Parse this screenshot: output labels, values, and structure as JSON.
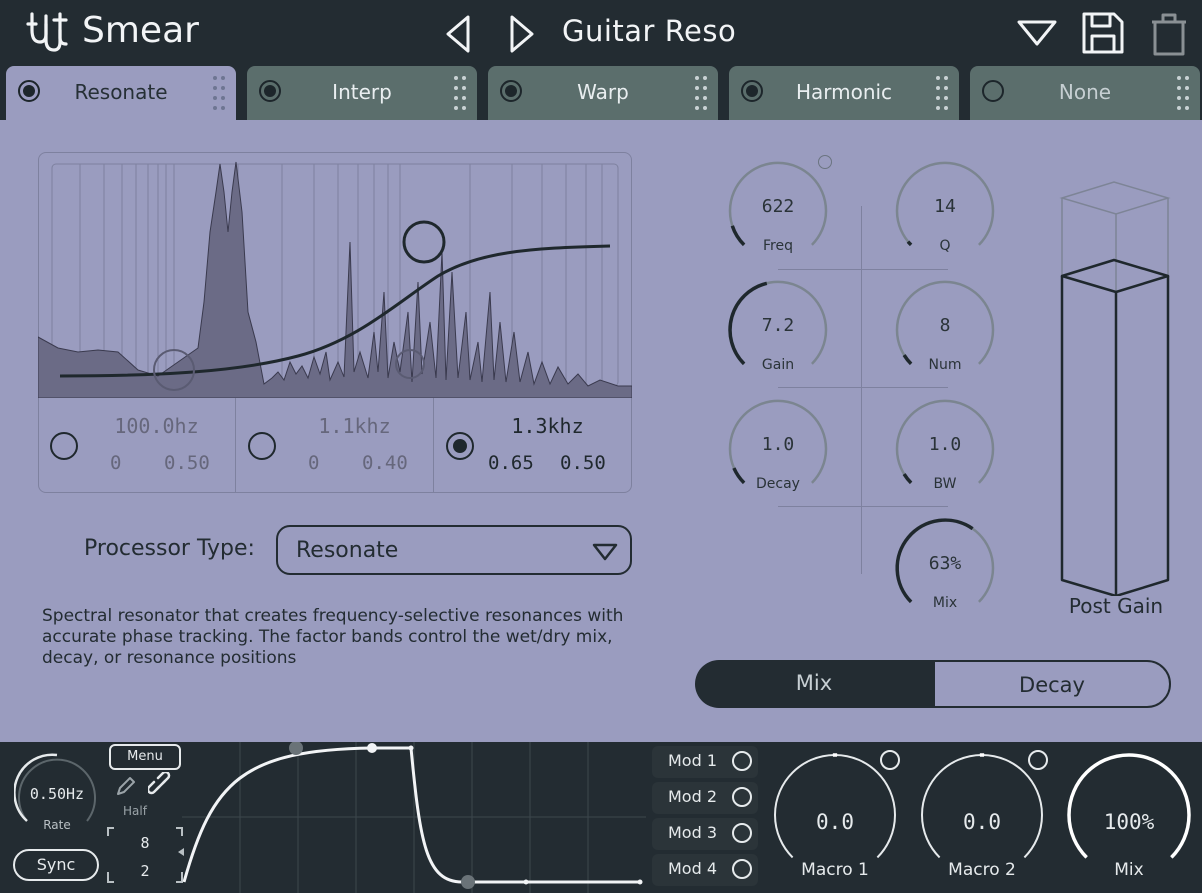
{
  "app": {
    "name": "Smear",
    "preset_name": "Guitar Reso"
  },
  "tabs": [
    {
      "label": "Resonate",
      "enabled": true
    },
    {
      "label": "Interp",
      "enabled": true
    },
    {
      "label": "Warp",
      "enabled": true
    },
    {
      "label": "Harmonic",
      "enabled": true
    },
    {
      "label": "None",
      "enabled": false
    }
  ],
  "bands": [
    {
      "freq": "100.0hz",
      "v1": "0",
      "v2": "0.50",
      "selected": false
    },
    {
      "freq": "1.1khz",
      "v1": "0",
      "v2": "0.40",
      "selected": false
    },
    {
      "freq": "1.3khz",
      "v1": "0.65",
      "v2": "0.50",
      "selected": true
    }
  ],
  "processor": {
    "label": "Processor Type:",
    "value": "Resonate"
  },
  "description": "Spectral resonator that creates frequency-selective resonances with accurate phase tracking. The factor bands control the wet/dry mix, decay, or resonance positions",
  "knobs": {
    "freq": {
      "value": "622",
      "label": "Freq",
      "level": 0.1
    },
    "q": {
      "value": "14",
      "label": "Q",
      "level": 0.02
    },
    "gain": {
      "value": "7.2",
      "label": "Gain",
      "level": 0.45
    },
    "num": {
      "value": "8",
      "label": "Num",
      "level": 0.05
    },
    "decay": {
      "value": "1.0",
      "label": "Decay",
      "level": 0.08
    },
    "bw": {
      "value": "1.0",
      "label": "BW",
      "level": 0.05
    },
    "mix": {
      "value": "63%",
      "label": "Mix",
      "level": 0.63
    }
  },
  "factor_mode": {
    "options": [
      "Mix",
      "Decay"
    ],
    "selected": "Mix"
  },
  "post_gain": {
    "label": "Post Gain",
    "level": 0.8
  },
  "lfo": {
    "rate": "0.50Hz",
    "rate_label": "Rate",
    "rate_level": 0.5,
    "sync_label": "Sync",
    "menu_label": "Menu",
    "half_label": "Half",
    "grid_x": "8",
    "grid_y": "2"
  },
  "mods": [
    "Mod 1",
    "Mod 2",
    "Mod 3",
    "Mod 4"
  ],
  "macros": [
    {
      "value": "0.0",
      "label": "Macro 1",
      "level": 0.0
    },
    {
      "value": "0.0",
      "label": "Macro 2",
      "level": 0.0
    },
    {
      "value": "100%",
      "label": "Mix",
      "level": 1.0
    }
  ],
  "colors": {
    "bg": "#9a9cbf",
    "dark": "#232c32",
    "tab": "#5b6e6c",
    "accent_light": "#e6eaec"
  }
}
